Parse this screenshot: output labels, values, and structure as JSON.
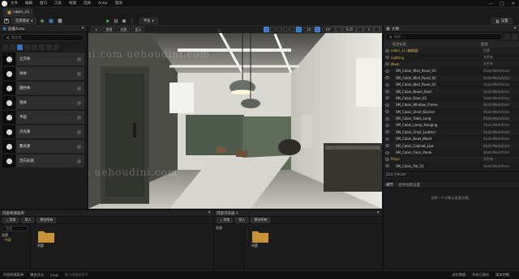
{
  "menubar": {
    "items": [
      "文件",
      "编辑",
      "窗口",
      "工具",
      "构建",
      "选择",
      "Actor",
      "帮助"
    ],
    "window_controls": [
      "—",
      "□",
      "✕"
    ]
  },
  "toolbar": {
    "level_tab": "cabin_v1",
    "save_icon": "save-icon",
    "mode_label": "选择模式",
    "play_icon": "play-icon",
    "platforms_label": "平台",
    "settings_label": "设置"
  },
  "place_actors": {
    "title": "放置Actor",
    "search_placeholder": "搜索类",
    "actors": [
      {
        "name": "立方体",
        "icon": "cube-icon"
      },
      {
        "name": "球体",
        "icon": "sphere-icon"
      },
      {
        "name": "圆柱体",
        "icon": "cylinder-icon"
      },
      {
        "name": "锥体",
        "icon": "cone-icon"
      },
      {
        "name": "平面",
        "icon": "plane-icon"
      },
      {
        "name": "点光源",
        "icon": "point-light-icon"
      },
      {
        "name": "聚光源",
        "icon": "spot-light-icon"
      },
      {
        "name": "定向光源",
        "icon": "directional-light-icon"
      }
    ]
  },
  "viewport": {
    "perspective_label": "透视",
    "lit_label": "光照",
    "show_label": "显示",
    "grid_value": "10",
    "angle_value": "10°",
    "scale_value": "0.25",
    "camera_speed": "4"
  },
  "outliner": {
    "title": "大纲",
    "search_placeholder": "搜索...",
    "col_label": "项目标签",
    "col_type": "类型",
    "rows": [
      {
        "label": "cabin_v1 (编辑器)",
        "type": "世界",
        "folder": true
      },
      {
        "label": "Lighting",
        "type": "文件夹",
        "folder": true
      },
      {
        "label": "Mesh",
        "type": "文件夹",
        "folder": true
      },
      {
        "label": "SM_Cabin_Wall_Panel_01",
        "type": "StaticMeshActor",
        "folder": false
      },
      {
        "label": "SM_Cabin_Wall_Panel_02",
        "type": "StaticMeshActor",
        "folder": false
      },
      {
        "label": "SM_Cabin_Wall_Panel_03",
        "type": "StaticMeshActor",
        "folder": false
      },
      {
        "label": "SM_Cabin_Beam_Roof",
        "type": "StaticMeshActor",
        "folder": false
      },
      {
        "label": "SM_Cabin_Door_01",
        "type": "StaticMeshActor",
        "folder": false
      },
      {
        "label": "SM_Cabin_Window_Frame",
        "type": "StaticMeshActor",
        "folder": false
      },
      {
        "label": "SM_Cabin_Shelf_Kitchen",
        "type": "StaticMeshActor",
        "folder": false
      },
      {
        "label": "SM_Cabin_Table_Long",
        "type": "StaticMeshActor",
        "folder": false
      },
      {
        "label": "SM_Cabin_Lamp_Hanging",
        "type": "StaticMeshActor",
        "folder": false
      },
      {
        "label": "SM_Cabin_Chair_Leather",
        "type": "StaticMeshActor",
        "folder": false
      },
      {
        "label": "SM_Cabin_Bowl_Wood",
        "type": "StaticMeshActor",
        "folder": false
      },
      {
        "label": "SM_Cabin_Cabinet_Low",
        "type": "StaticMeshActor",
        "folder": false
      },
      {
        "label": "SM_Cabin_Floor_Plank",
        "type": "StaticMeshActor",
        "folder": false
      },
      {
        "label": "Props",
        "type": "文件夹",
        "folder": true
      },
      {
        "label": "SM_Cabin_Pot_01",
        "type": "StaticMeshActor",
        "folder": false
      },
      {
        "label": "SM_Cabin_Pot_02",
        "type": "StaticMeshActor",
        "folder": false
      },
      {
        "label": "SM_Cabin_Book_Stack",
        "type": "StaticMeshActor",
        "folder": false
      },
      {
        "label": "SM_Cabin_Vase_01",
        "type": "StaticMeshActor",
        "folder": false
      }
    ],
    "count_label": "214 个Actor"
  },
  "details": {
    "tab_details": "细节",
    "tab_world": "世界场景设置",
    "empty_text": "选择一个对象以查看详情。"
  },
  "content_browser_1": {
    "title": "内容侧滑菜单",
    "add_label": "添加",
    "import_label": "导入",
    "save_all_label": "保存所有",
    "search_label": "搜索",
    "root_folder": "全部",
    "sub_folder": "内容",
    "folder_label": "内容"
  },
  "content_browser_2": {
    "title": "内容浏览器 2",
    "add_label": "添加",
    "import_label": "导入",
    "save_all_label": "保存所有",
    "root_folder": "全部",
    "folder_label": "内容"
  },
  "statusbar": {
    "items": [
      "内容侧滑菜单",
      "输出日志",
      "Cmd",
      "输入控制台命令"
    ],
    "right_items": [
      "派生数据",
      "所有已保存",
      "版本控制"
    ]
  },
  "watermark": "uehoudini.com  uehoudini.com",
  "colors": {
    "accent_blue": "#3773b8",
    "play_green": "#3ab54a",
    "folder_yellow": "#c9933a"
  }
}
